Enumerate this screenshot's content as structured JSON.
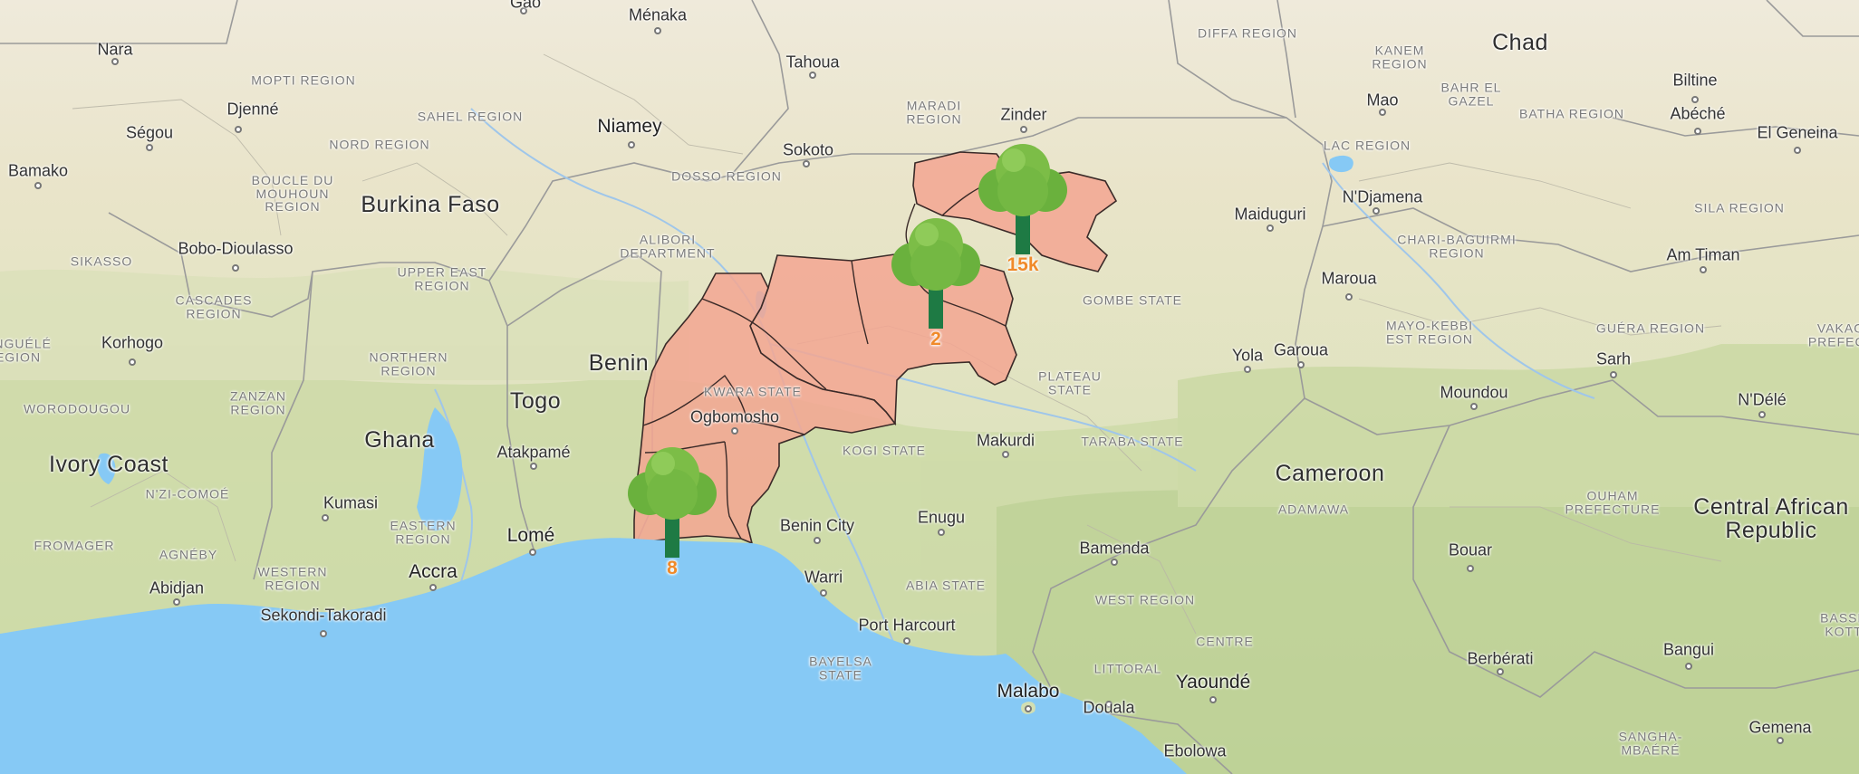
{
  "map": {
    "colors": {
      "land": "#eae6cf",
      "vegetation": "#d3dfb2",
      "water": "#86c9f5",
      "highlight_fill": "#f3a692",
      "highlight_stroke": "#3a2a28",
      "count_text": "#f08a2a",
      "tree_foliage": "#74b843",
      "tree_trunk": "#1e7a44"
    },
    "countries": [
      {
        "id": "chad",
        "label": "Chad"
      },
      {
        "id": "burkina-faso",
        "label": "Burkina Faso"
      },
      {
        "id": "benin",
        "label": "Benin"
      },
      {
        "id": "togo",
        "label": "Togo"
      },
      {
        "id": "ghana",
        "label": "Ghana"
      },
      {
        "id": "ivory-coast",
        "label": "Ivory Coast"
      },
      {
        "id": "cameroon",
        "label": "Cameroon"
      },
      {
        "id": "central-african-republic",
        "label": "Central African Republic"
      }
    ],
    "cities": [
      {
        "id": "gao",
        "label": "Gao"
      },
      {
        "id": "menaka",
        "label": "Ménaka"
      },
      {
        "id": "nara",
        "label": "Nara"
      },
      {
        "id": "tahoua",
        "label": "Tahoua"
      },
      {
        "id": "zinder",
        "label": "Zinder"
      },
      {
        "id": "mao",
        "label": "Mao"
      },
      {
        "id": "biltine",
        "label": "Biltine"
      },
      {
        "id": "abeche",
        "label": "Abéché"
      },
      {
        "id": "el-geneina",
        "label": "El Geneina"
      },
      {
        "id": "djenne",
        "label": "Djenné"
      },
      {
        "id": "segou",
        "label": "Ségou"
      },
      {
        "id": "niamey",
        "label": "Niamey"
      },
      {
        "id": "sokoto",
        "label": "Sokoto"
      },
      {
        "id": "bamako",
        "label": "Bamako"
      },
      {
        "id": "ndjamena",
        "label": "N'Djamena"
      },
      {
        "id": "maiduguri",
        "label": "Maiduguri"
      },
      {
        "id": "bobo-dioulasso",
        "label": "Bobo-Dioulasso"
      },
      {
        "id": "am-timan",
        "label": "Am Timan"
      },
      {
        "id": "maroua",
        "label": "Maroua"
      },
      {
        "id": "korhogo",
        "label": "Korhogo"
      },
      {
        "id": "yola",
        "label": "Yola"
      },
      {
        "id": "garoua",
        "label": "Garoua"
      },
      {
        "id": "sarh",
        "label": "Sarh"
      },
      {
        "id": "moundou",
        "label": "Moundou"
      },
      {
        "id": "ndele",
        "label": "N'Délé"
      },
      {
        "id": "ogbomosho",
        "label": "Ogbomosho"
      },
      {
        "id": "atakpame",
        "label": "Atakpamé"
      },
      {
        "id": "makurdi",
        "label": "Makurdi"
      },
      {
        "id": "kumasi",
        "label": "Kumasi"
      },
      {
        "id": "benin-city",
        "label": "Benin City"
      },
      {
        "id": "enugu",
        "label": "Enugu"
      },
      {
        "id": "lome",
        "label": "Lomé"
      },
      {
        "id": "bamenda",
        "label": "Bamenda"
      },
      {
        "id": "bouar",
        "label": "Bouar"
      },
      {
        "id": "accra",
        "label": "Accra"
      },
      {
        "id": "abidjan",
        "label": "Abidjan"
      },
      {
        "id": "warri",
        "label": "Warri"
      },
      {
        "id": "sekondi-takoradi",
        "label": "Sekondi-Takoradi"
      },
      {
        "id": "port-harcourt",
        "label": "Port Harcourt"
      },
      {
        "id": "berberati",
        "label": "Berbérati"
      },
      {
        "id": "bangui",
        "label": "Bangui"
      },
      {
        "id": "yaounde",
        "label": "Yaoundé"
      },
      {
        "id": "malabo",
        "label": "Malabo"
      },
      {
        "id": "douala",
        "label": "Douala"
      },
      {
        "id": "gemena",
        "label": "Gemena"
      },
      {
        "id": "ebolowa",
        "label": "Ebolowa"
      }
    ],
    "regions": [
      {
        "id": "diffa-region",
        "label": "DIFFA REGION"
      },
      {
        "id": "kanem-region",
        "label": "KANEM REGION"
      },
      {
        "id": "bahr-el-gazel",
        "label": "BAHR EL GAZEL"
      },
      {
        "id": "batha-region",
        "label": "BATHA REGION"
      },
      {
        "id": "mopti-region",
        "label": "MOPTI REGION"
      },
      {
        "id": "maradi-region",
        "label": "MARADI REGION"
      },
      {
        "id": "sahel-region",
        "label": "SAHEL REGION"
      },
      {
        "id": "nord-region",
        "label": "NORD REGION"
      },
      {
        "id": "lac-region",
        "label": "LAC REGION"
      },
      {
        "id": "dosso-region",
        "label": "DOSSO REGION"
      },
      {
        "id": "boucle-du-mouhoun-region",
        "label": "BOUCLE DU MOUHOUN REGION"
      },
      {
        "id": "sila-region",
        "label": "SILA REGION"
      },
      {
        "id": "chari-baguirmi-region",
        "label": "CHARI-BAGUIRMI REGION"
      },
      {
        "id": "alibori-department",
        "label": "ALIBORI DEPARTMENT"
      },
      {
        "id": "sikasso",
        "label": "SIKASSO"
      },
      {
        "id": "upper-east-region",
        "label": "UPPER EAST REGION"
      },
      {
        "id": "gombe-state",
        "label": "GOMBE STATE"
      },
      {
        "id": "cascades-region",
        "label": "CASCADES REGION"
      },
      {
        "id": "mayo-kebbi-est-region",
        "label": "MAYO-KEBBI EST REGION"
      },
      {
        "id": "guera-region",
        "label": "GUÉRA REGION"
      },
      {
        "id": "vakaga-prefecture",
        "label": "VAKAG PREFECT"
      },
      {
        "id": "zanzan-region",
        "label": "ZANZAN REGION"
      },
      {
        "id": "northern-region",
        "label": "NORTHERN REGION"
      },
      {
        "id": "kwara-state",
        "label": "KWARA STATE"
      },
      {
        "id": "plateau-state",
        "label": "PLATEAU STATE"
      },
      {
        "id": "woroudougou",
        "label": "WORODOUGOU"
      },
      {
        "id": "denguele-region",
        "label": "ENGUÉLÉ EGION"
      },
      {
        "id": "taraba-state",
        "label": "TARABA STATE"
      },
      {
        "id": "kogi-state",
        "label": "KOGI STATE"
      },
      {
        "id": "nzi-comoe",
        "label": "N'ZI-COMOÉ"
      },
      {
        "id": "adamawa",
        "label": "ADAMAWA"
      },
      {
        "id": "ouham-prefecture",
        "label": "OUHAM PREFECTURE"
      },
      {
        "id": "eastern-region",
        "label": "EASTERN REGION"
      },
      {
        "id": "fromager",
        "label": "FROMAGER"
      },
      {
        "id": "agneby",
        "label": "AGNÉBY"
      },
      {
        "id": "western-region",
        "label": "WESTERN REGION"
      },
      {
        "id": "abia-state",
        "label": "ABIA STATE"
      },
      {
        "id": "basse-kotto",
        "label": "BASSE KOTT"
      },
      {
        "id": "west-region",
        "label": "WEST REGION"
      },
      {
        "id": "bayelsa-state",
        "label": "BAYELSA STATE"
      },
      {
        "id": "centre",
        "label": "CENTRE"
      },
      {
        "id": "littoral",
        "label": "LITTORAL"
      },
      {
        "id": "sangha-mbaere",
        "label": "SANGHA-MBAÉRÉ"
      }
    ],
    "markers": [
      {
        "id": "marker-15k",
        "icon": "tree-icon",
        "count": "15k"
      },
      {
        "id": "marker-2",
        "icon": "tree-icon",
        "count": "2"
      },
      {
        "id": "marker-8",
        "icon": "tree-icon",
        "count": "8"
      }
    ]
  }
}
